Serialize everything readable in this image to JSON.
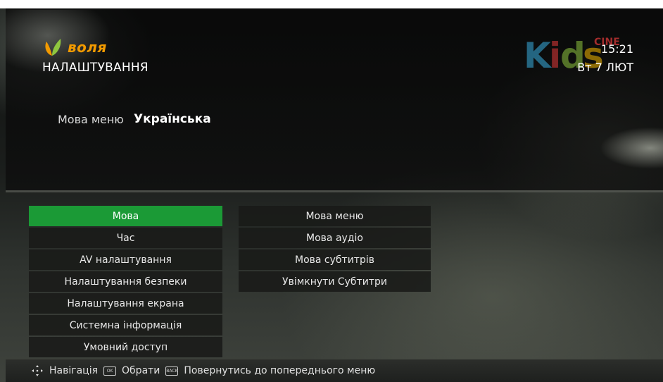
{
  "brand": {
    "name": "воля",
    "color": "#f29a00"
  },
  "page_title": "НАЛАШТУВАННЯ",
  "channel_logo": {
    "text": "Kids",
    "badge": "CINE",
    "colors": [
      "#3ab0e2",
      "#e33a3a",
      "#8fc63f",
      "#f5b800"
    ]
  },
  "clock": {
    "time": "15:21",
    "date": "Вт 7 ЛЮТ"
  },
  "current_setting": {
    "label": "Мова меню",
    "value": "Українська"
  },
  "menu": {
    "active_color": "#1b9a36",
    "items": [
      {
        "label": "Мова",
        "active": true
      },
      {
        "label": "Час"
      },
      {
        "label": "AV налаштування"
      },
      {
        "label": "Налаштування безпеки"
      },
      {
        "label": "Налаштування екрана"
      },
      {
        "label": "Системна інформація"
      },
      {
        "label": "Умовний доступ"
      }
    ]
  },
  "submenu": {
    "items": [
      {
        "label": "Мова меню"
      },
      {
        "label": "Мова аудіо"
      },
      {
        "label": "Мова субтитрів"
      },
      {
        "label": "Увімкнути Субтитри"
      }
    ]
  },
  "hints": {
    "nav_icon": "dpad-arrows-icon",
    "navigation": "Навігація",
    "ok_key": "OK",
    "select": "Обрати",
    "back_key": "BACK",
    "back": "Повернутись до попереднього меню"
  }
}
